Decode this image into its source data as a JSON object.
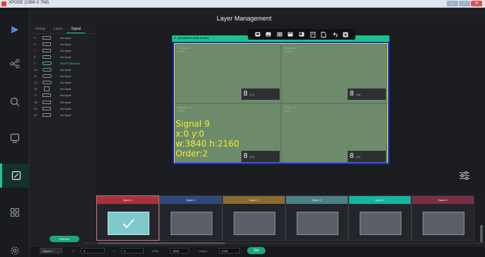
{
  "window": {
    "title": "XPOSE (1366 X 768)"
  },
  "header": {
    "title": "Layer Management"
  },
  "sidebar": {
    "items": [
      {
        "icon": "play-logo-icon"
      },
      {
        "icon": "network-icon"
      },
      {
        "icon": "search-icon"
      },
      {
        "icon": "screen-icon"
      },
      {
        "icon": "edit-icon",
        "active": true
      },
      {
        "icon": "grid-icon"
      },
      {
        "icon": "gear-icon"
      }
    ]
  },
  "signal_panel": {
    "tabs": [
      "Group",
      "Layer",
      "Signal"
    ],
    "active_tab": "Signal",
    "rows": [
      {
        "num": "5",
        "port": "hdmi",
        "label": "No Input"
      },
      {
        "num": "6",
        "port": "hdmi",
        "label": "No Input"
      },
      {
        "num": "7",
        "port": "hdmi",
        "label": "No Input"
      },
      {
        "num": "8",
        "port": "hdmi",
        "label": "No Input"
      },
      {
        "num": "9",
        "port": "dp",
        "label": "3920*1080@60",
        "active": true
      },
      {
        "num": "10",
        "port": "dp",
        "label": "No Input"
      },
      {
        "num": "11",
        "port": "dp",
        "label": "No Input"
      },
      {
        "num": "12",
        "port": "dp",
        "label": "No Input"
      },
      {
        "num": "13",
        "port": "vga",
        "label": "No Input"
      },
      {
        "num": "17",
        "port": "sdi",
        "label": "No Input"
      },
      {
        "num": "18",
        "port": "sdi",
        "label": "No Input"
      },
      {
        "num": "29",
        "port": "sdi",
        "label": "No Input"
      },
      {
        "num": "30",
        "port": "sdi",
        "label": "No Input"
      }
    ],
    "refresh_label": "Refresh"
  },
  "layer": {
    "header_text": "9 - (W:3840 H:2160 9.23%)",
    "signal_line": "Signal  9",
    "pos_line": "x:0  y:0",
    "size_line": "w:3840  h:2160",
    "order_line": "Order:2"
  },
  "toolbar": {
    "icons": [
      "layer-front-icon",
      "layer-up-icon",
      "layer-scale-icon",
      "layer-down-icon",
      "layer-back-icon",
      "copy-icon",
      "paste-icon",
      "undo-icon",
      "close-icon"
    ]
  },
  "displays": [
    {
      "name": "Display 17",
      "port": "HDMI",
      "badge": "8",
      "badge_sub": "[17]"
    },
    {
      "name": "Display 18",
      "port": "HDMI",
      "badge": "8",
      "badge_sub": "[18]"
    },
    {
      "name": "Display 19",
      "port": "HDMI",
      "badge": "8",
      "badge_sub": "[19]"
    },
    {
      "name": "Display 20",
      "port": "HDMI",
      "badge": "8",
      "badge_sub": "[20]"
    }
  ],
  "banks": [
    {
      "label": "Bank 1",
      "color": "#a8323c",
      "selected": true
    },
    {
      "label": "Bank 2",
      "color": "#2f4a7a"
    },
    {
      "label": "Bank 3",
      "color": "#8a6a2e"
    },
    {
      "label": "Bank 4",
      "color": "#4d7f86"
    },
    {
      "label": "Bank 5",
      "color": "#14b5a0"
    },
    {
      "label": "Bank 6",
      "color": "#7a2e44"
    }
  ],
  "bottom": {
    "signal_select": "Signal  9",
    "x_label": "X",
    "x_value": "0",
    "y_label": "Y",
    "y_value": "0",
    "width_label": "Width",
    "width_value": "3840",
    "height_label": "Height",
    "height_value": "2160",
    "set_label": "Set"
  },
  "colors": {
    "accent": "#1ec98e",
    "output_fill": "#6d8b6a",
    "layer_border": "#1530e8",
    "layer_text": "#f3ee2c"
  }
}
